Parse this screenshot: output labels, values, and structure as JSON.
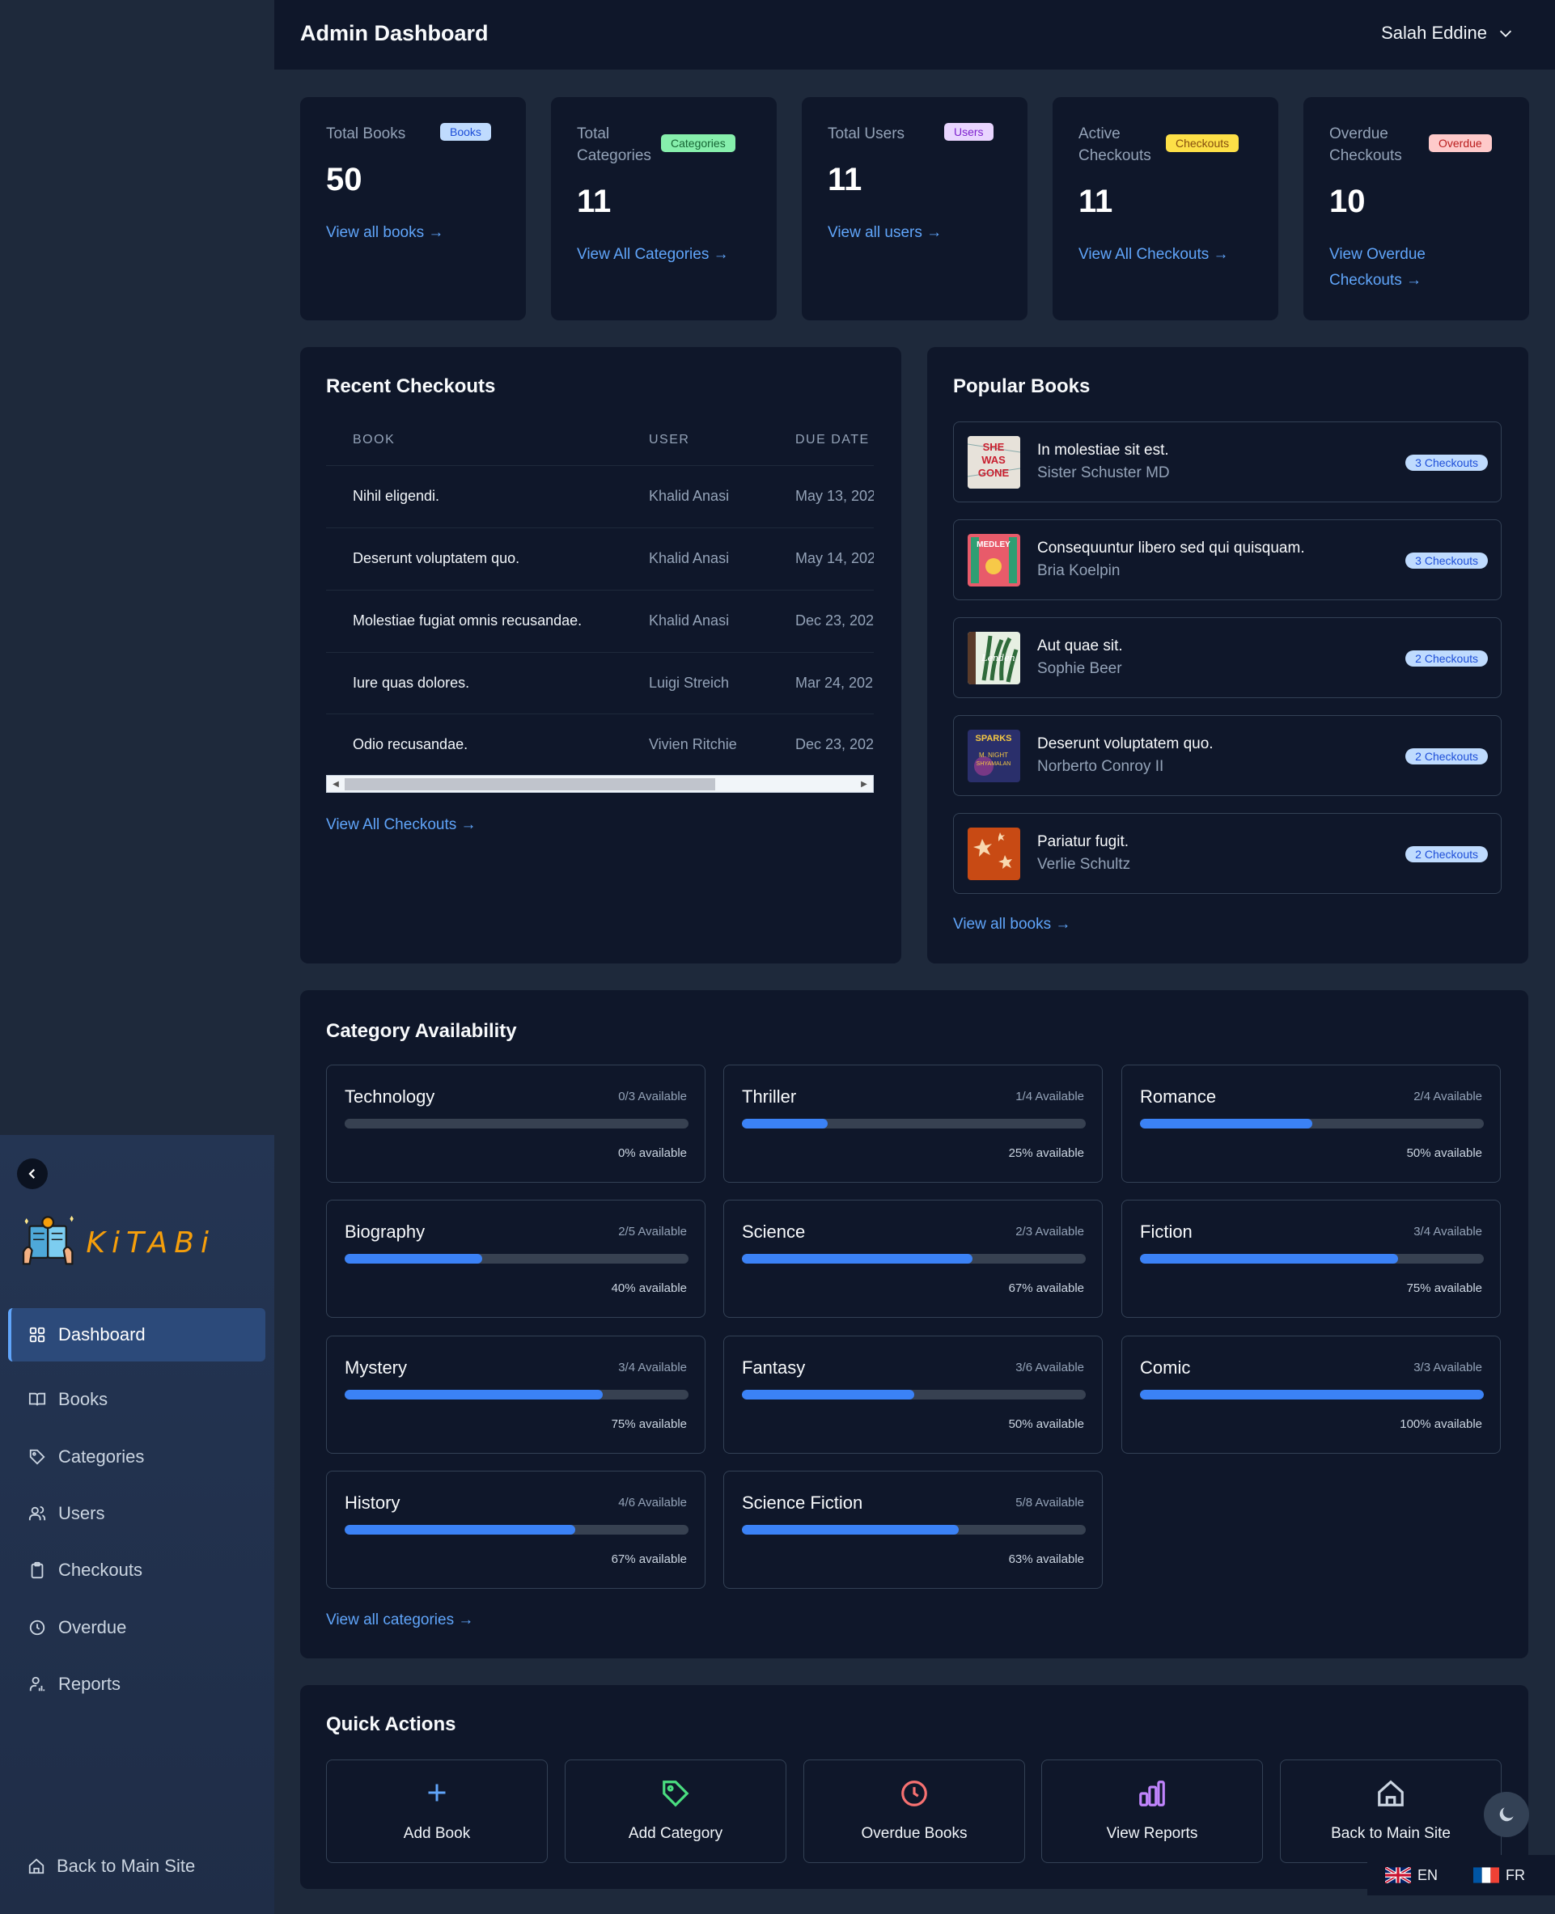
{
  "header": {
    "title": "Admin Dashboard",
    "user_name": "Salah Eddine"
  },
  "sidebar": {
    "logo_text": "KiTABi",
    "items": [
      {
        "label": "Dashboard",
        "icon": "grid-icon",
        "active": true
      },
      {
        "label": "Books",
        "icon": "book-icon"
      },
      {
        "label": "Categories",
        "icon": "tag-icon"
      },
      {
        "label": "Users",
        "icon": "users-icon"
      },
      {
        "label": "Checkouts",
        "icon": "clipboard-icon"
      },
      {
        "label": "Overdue",
        "icon": "clock-icon"
      },
      {
        "label": "Reports",
        "icon": "reports-icon"
      }
    ],
    "back_label": "Back to Main Site"
  },
  "stats": [
    {
      "label": "Total Books",
      "badge": "Books",
      "value": "50",
      "link": "View all books →",
      "badge_color": "#bfdbfe",
      "badge_text_color": "#1d4ed8"
    },
    {
      "label": "Total Categories",
      "badge": "Categories",
      "value": "11",
      "link": "View All Categories →",
      "badge_color": "#86efac",
      "badge_text_color": "#166534"
    },
    {
      "label": "Total Users",
      "badge": "Users",
      "value": "11",
      "link": "View all users →",
      "badge_color": "#e9d5ff",
      "badge_text_color": "#7e22ce"
    },
    {
      "label": "Active Checkouts",
      "badge": "Checkouts",
      "value": "11",
      "link": "View All Checkouts →",
      "badge_color": "#fde047",
      "badge_text_color": "#854d0e"
    },
    {
      "label": "Overdue Checkouts",
      "badge": "Overdue",
      "value": "10",
      "link": "View Overdue Checkouts →",
      "badge_color": "#fecaca",
      "badge_text_color": "#b91c1c"
    }
  ],
  "recent_checkouts": {
    "title": "Recent Checkouts",
    "columns": [
      "BOOK",
      "USER",
      "DUE DATE"
    ],
    "rows": [
      {
        "book": "Nihil eligendi.",
        "user": "Khalid Anasi",
        "due": "May 13, 202"
      },
      {
        "book": "Deserunt voluptatem quo.",
        "user": "Khalid Anasi",
        "due": "May 14, 202"
      },
      {
        "book": "Molestiae fugiat omnis recusandae.",
        "user": "Khalid Anasi",
        "due": "Dec 23, 202"
      },
      {
        "book": "Iure quas dolores.",
        "user": "Luigi Streich",
        "due": "Mar 24, 202"
      },
      {
        "book": "Odio recusandae.",
        "user": "Vivien Ritchie",
        "due": "Dec 23, 202"
      }
    ],
    "link": "View All Checkouts →"
  },
  "popular_books": {
    "title": "Popular Books",
    "items": [
      {
        "title": "In molestiae sit est.",
        "author": "Sister Schuster MD",
        "checkouts": "3 Checkouts",
        "cover_bg": "#e7e2da",
        "cover_text": "SHE WAS GONE",
        "cover_fg": "#c81e2e"
      },
      {
        "title": "Consequuntur libero sed qui quisquam.",
        "author": "Bria Koelpin",
        "checkouts": "3 Checkouts",
        "cover_bg": "#e85b6a",
        "cover_text": "MEDLEY",
        "cover_fg": "#2f9e73"
      },
      {
        "title": "Aut quae sit.",
        "author": "Sophie Beer",
        "checkouts": "2 Checkouts",
        "cover_bg": "#2f6b3b",
        "cover_text": "Lenden",
        "cover_fg": "#e6f2e4"
      },
      {
        "title": "Deserunt voluptatem quo.",
        "author": "Norberto Conroy II",
        "checkouts": "2 Checkouts",
        "cover_bg": "#2a2f6b",
        "cover_text": "SPARKS",
        "cover_fg": "#f5c842"
      },
      {
        "title": "Pariatur fugit.",
        "author": "Verlie Schultz",
        "checkouts": "2 Checkouts",
        "cover_bg": "#c84a14",
        "cover_text": "✸ ✸",
        "cover_fg": "#f8d8b0"
      }
    ],
    "link": "View all books →"
  },
  "categories": {
    "title": "Category Availability",
    "items": [
      {
        "name": "Technology",
        "available": "0/3 Available",
        "percent": 0,
        "percent_label": "0% available"
      },
      {
        "name": "Thriller",
        "available": "1/4 Available",
        "percent": 25,
        "percent_label": "25% available"
      },
      {
        "name": "Romance",
        "available": "2/4 Available",
        "percent": 50,
        "percent_label": "50% available"
      },
      {
        "name": "Biography",
        "available": "2/5 Available",
        "percent": 40,
        "percent_label": "40% available"
      },
      {
        "name": "Science",
        "available": "2/3 Available",
        "percent": 67,
        "percent_label": "67% available"
      },
      {
        "name": "Fiction",
        "available": "3/4 Available",
        "percent": 75,
        "percent_label": "75% available"
      },
      {
        "name": "Mystery",
        "available": "3/4 Available",
        "percent": 75,
        "percent_label": "75% available"
      },
      {
        "name": "Fantasy",
        "available": "3/6 Available",
        "percent": 50,
        "percent_label": "50% available"
      },
      {
        "name": "Comic",
        "available": "3/3 Available",
        "percent": 100,
        "percent_label": "100% available"
      },
      {
        "name": "History",
        "available": "4/6 Available",
        "percent": 67,
        "percent_label": "67% available"
      },
      {
        "name": "Science Fiction",
        "available": "5/8 Available",
        "percent": 63,
        "percent_label": "63% available"
      }
    ],
    "link": "View all categories →"
  },
  "quick_actions": {
    "title": "Quick Actions",
    "items": [
      {
        "label": "Add Book",
        "icon": "plus-icon",
        "color": "#60a5fa"
      },
      {
        "label": "Add Category",
        "icon": "tag-icon",
        "color": "#4ade80"
      },
      {
        "label": "Overdue Books",
        "icon": "clock-icon",
        "color": "#f87171"
      },
      {
        "label": "View Reports",
        "icon": "bar-chart-icon",
        "color": "#c084fc"
      },
      {
        "label": "Back to Main Site",
        "icon": "home-icon",
        "color": "#cbd5e1"
      }
    ]
  },
  "languages": [
    {
      "code": "EN",
      "flag": "uk-flag-icon"
    },
    {
      "code": "FR",
      "flag": "france-flag-icon"
    }
  ],
  "colors": {
    "accent": "#3b82f6",
    "link": "#60a5fa",
    "background": "#1e293b",
    "card": "#0f172a"
  }
}
